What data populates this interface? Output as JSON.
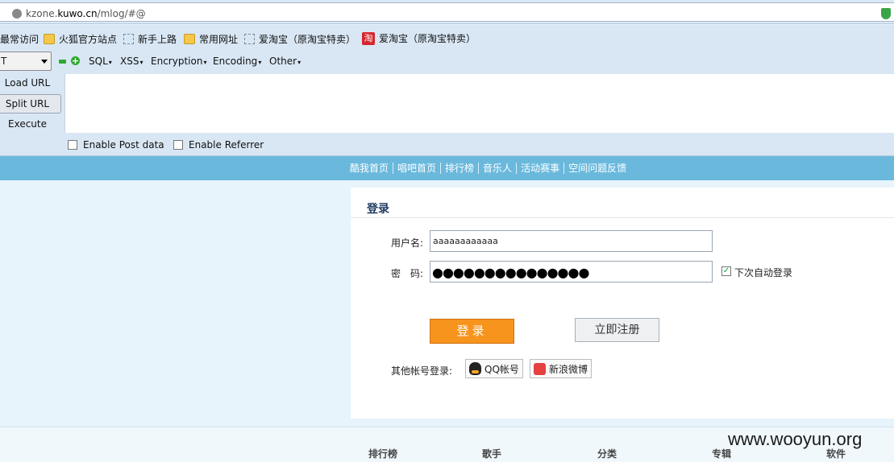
{
  "browser": {
    "url_host_prefix": "kzone.",
    "url_host_main": "kuwo.cn",
    "url_path": "/mlog/#@",
    "bookmarks": [
      {
        "label": "最常访问",
        "icon": "none"
      },
      {
        "label": "火狐官方站点",
        "icon": "folder-icon"
      },
      {
        "label": "新手上路",
        "icon": "dashed-box-icon"
      },
      {
        "label": "常用网址",
        "icon": "folder-icon"
      },
      {
        "label": "爱淘宝（原淘宝特卖）",
        "icon": "dashed-box-icon"
      },
      {
        "label": "爱淘宝（原淘宝特卖）",
        "icon": "taobao-icon"
      }
    ],
    "taobao_glyph": "淘"
  },
  "hackbar": {
    "select_value": "T",
    "menus": [
      "SQL",
      "XSS",
      "Encryption",
      "Encoding",
      "Other"
    ],
    "buttons": [
      "Load URL",
      "Split URL",
      "Execute"
    ],
    "textarea_value": "",
    "checks": [
      "Enable Post data",
      "Enable Referrer"
    ]
  },
  "site_nav": [
    "酷我首页",
    "唱吧首页",
    "排行榜",
    "音乐人",
    "活动赛事",
    "空间问题反馈"
  ],
  "login": {
    "title": "登录",
    "username_label": "用户名:",
    "username_value": "aaaaaaaaaaaa",
    "password_label": "密　码:",
    "password_value": "●●●●●●●●●●●●●●●",
    "auto_login_label": "下次自动登录",
    "auto_login_checked": true,
    "auto_login_mark": "✓",
    "login_button": "登录",
    "register_button": "立即注册",
    "other_label": "其他帐号登录:",
    "qq_button": "QQ帐号",
    "weibo_button": "新浪微博"
  },
  "footer": [
    "排行榜",
    "歌手",
    "分类",
    "专辑",
    "软件"
  ],
  "watermark": "www.wooyun.org",
  "colors": {
    "nav": "#6ab9dd",
    "login_button": "#f7941d",
    "page_bg": "#e8f4fb"
  }
}
